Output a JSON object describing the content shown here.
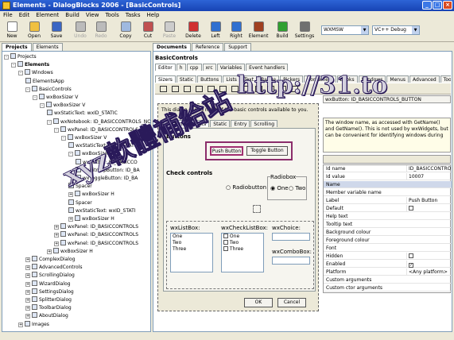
{
  "window": {
    "title": "Elements - DialogBlocks 2006 - [BasicControls]"
  },
  "menu": [
    "File",
    "Edit",
    "Element",
    "Build",
    "View",
    "Tools",
    "Tasks",
    "Help"
  ],
  "toolbar": {
    "buttons": [
      "New",
      "Open",
      "Save",
      "Undo",
      "Redo",
      "Copy",
      "Cut",
      "Paste",
      "Delete",
      "Left",
      "Right",
      "Element",
      "Build",
      "Settings"
    ],
    "config_combo": "WXMSW",
    "compiler_combo": "VC++ Debug"
  },
  "left_panel": {
    "tabs": [
      "Projects",
      "Elements"
    ],
    "tree": [
      {
        "label": "Projects",
        "indent": 0,
        "exp": "-"
      },
      {
        "label": "Elements",
        "indent": 1,
        "exp": "-",
        "bold": true
      },
      {
        "label": "Windows",
        "indent": 2,
        "exp": "-"
      },
      {
        "label": "ElementsApp",
        "indent": 3,
        "exp": ""
      },
      {
        "label": "BasicControls",
        "indent": 3,
        "exp": "-"
      },
      {
        "label": "wxBoxSizer V",
        "indent": 4,
        "exp": "-"
      },
      {
        "label": "wxBoxSizer V",
        "indent": 5,
        "exp": "-"
      },
      {
        "label": "wxStaticText: wxID_STATIC",
        "indent": 6,
        "exp": ""
      },
      {
        "label": "wxNotebook: ID_BASICCONTROLS_NO",
        "indent": 6,
        "exp": "-"
      },
      {
        "label": "wxPanel: ID_BASICCONTROLS_PA",
        "indent": 7,
        "exp": "-"
      },
      {
        "label": "wxBoxSizer V",
        "indent": 8,
        "exp": "-"
      },
      {
        "label": "wxStaticText: wxID_STATIC",
        "indent": 9,
        "exp": ""
      },
      {
        "label": "wxBoxSizer H",
        "indent": 9,
        "exp": "-"
      },
      {
        "label": "wxButton: ID_BASICCO",
        "indent": 10,
        "exp": ""
      },
      {
        "label": "wxBitmapButton: ID_BA",
        "indent": 10,
        "exp": ""
      },
      {
        "label": "wxToggleButton: ID_BA",
        "indent": 10,
        "exp": ""
      },
      {
        "label": "Spacer",
        "indent": 9,
        "exp": ""
      },
      {
        "label": "wxBoxSizer H",
        "indent": 9,
        "exp": "+"
      },
      {
        "label": "Spacer",
        "indent": 9,
        "exp": ""
      },
      {
        "label": "wxStaticText: wxID_STATI",
        "indent": 9,
        "exp": ""
      },
      {
        "label": "wxBoxSizer H",
        "indent": 9,
        "exp": "+"
      },
      {
        "label": "wxPanel: ID_BASICCONTROLS",
        "indent": 7,
        "exp": "+"
      },
      {
        "label": "wxPanel: ID_BASICCONTROLS",
        "indent": 7,
        "exp": "+"
      },
      {
        "label": "wxPanel: ID_BASICCONTROLS",
        "indent": 7,
        "exp": "+"
      },
      {
        "label": "wxBoxSizer H",
        "indent": 6,
        "exp": "+"
      },
      {
        "label": "ComplexDialog",
        "indent": 3,
        "exp": "+"
      },
      {
        "label": "AdvancedControls",
        "indent": 3,
        "exp": "+"
      },
      {
        "label": "ScrollingDialog",
        "indent": 3,
        "exp": "+"
      },
      {
        "label": "WizardDialog",
        "indent": 3,
        "exp": "+"
      },
      {
        "label": "SettingsDialog",
        "indent": 3,
        "exp": "+"
      },
      {
        "label": "SplitterDialog",
        "indent": 3,
        "exp": "+"
      },
      {
        "label": "ToolbarDialog",
        "indent": 3,
        "exp": "+"
      },
      {
        "label": "AboutDialog",
        "indent": 3,
        "exp": "+"
      },
      {
        "label": "Images",
        "indent": 2,
        "exp": "+"
      }
    ]
  },
  "doc_tabs": [
    "Documents",
    "Reference",
    "Support"
  ],
  "document": {
    "title": "BasicControls",
    "editor_tabs": [
      "Editor",
      "h",
      "cpp",
      "xrc",
      "Variables",
      "Event handlers"
    ],
    "palette_tabs": [
      "Sizers",
      "Static",
      "Buttons",
      "Lists",
      "Text",
      "Range",
      "Pickers",
      "Containers",
      "Books",
      "Windows",
      "Menus",
      "Advanced",
      "Toolbar"
    ],
    "description": "This dialog shows most of the basic controls available to you.",
    "page_tabs": [
      "Buttons and lists",
      "Static",
      "Entry",
      "Scrolling"
    ],
    "buttons_heading": "Buttons",
    "push_button": "Push Button",
    "toggle_button": "Toggle Button",
    "check_heading": "Check controls",
    "radiobox_label": "Radiobox",
    "radiobutton_label": "Radiobutton",
    "radio_one": "One",
    "radio_two": "Two",
    "listbox_label": "wxListBox:",
    "checklist_label": "wxCheckListBox:",
    "choice_label": "wxChoice:",
    "combobox_label": "wxComboBox:",
    "list_items": [
      "One",
      "Two",
      "Three"
    ],
    "ok_label": "OK",
    "cancel_label": "Cancel"
  },
  "properties": {
    "header": "wxButton: ID_BASICCONTROLS_BUTTON",
    "help": "The window name, as accessed with GetName() and GetName(). This is not used by wxWidgets, but can be convenient for identifying windows during",
    "rows": [
      {
        "k": "Id name",
        "v": "ID_BASICCONTROLS"
      },
      {
        "k": "Id value",
        "v": "10007"
      },
      {
        "k": "Name",
        "v": ""
      },
      {
        "k": "Member variable name",
        "v": ""
      },
      {
        "k": "Label",
        "v": "Push Button"
      },
      {
        "k": "Default",
        "v": "",
        "check": ""
      },
      {
        "k": "Help text",
        "v": ""
      },
      {
        "k": "Tooltip text",
        "v": ""
      },
      {
        "k": "Background colour",
        "v": ""
      },
      {
        "k": "Foreground colour",
        "v": ""
      },
      {
        "k": "Font",
        "v": ""
      },
      {
        "k": "Hidden",
        "v": "",
        "check": ""
      },
      {
        "k": "Enabled",
        "v": "",
        "check": "✓"
      },
      {
        "k": "Platform",
        "v": "<Any platform>"
      },
      {
        "k": "Custom arguments",
        "v": ""
      },
      {
        "k": "Custom ctor arguments",
        "v": ""
      }
    ]
  },
  "watermark": {
    "url": "http://31.to",
    "cjk": "xyz軟體補給站"
  },
  "colors": {
    "titlebar": "#1f52c7",
    "selection": "#316ac5",
    "dialog_bg": "#ece9d8"
  }
}
